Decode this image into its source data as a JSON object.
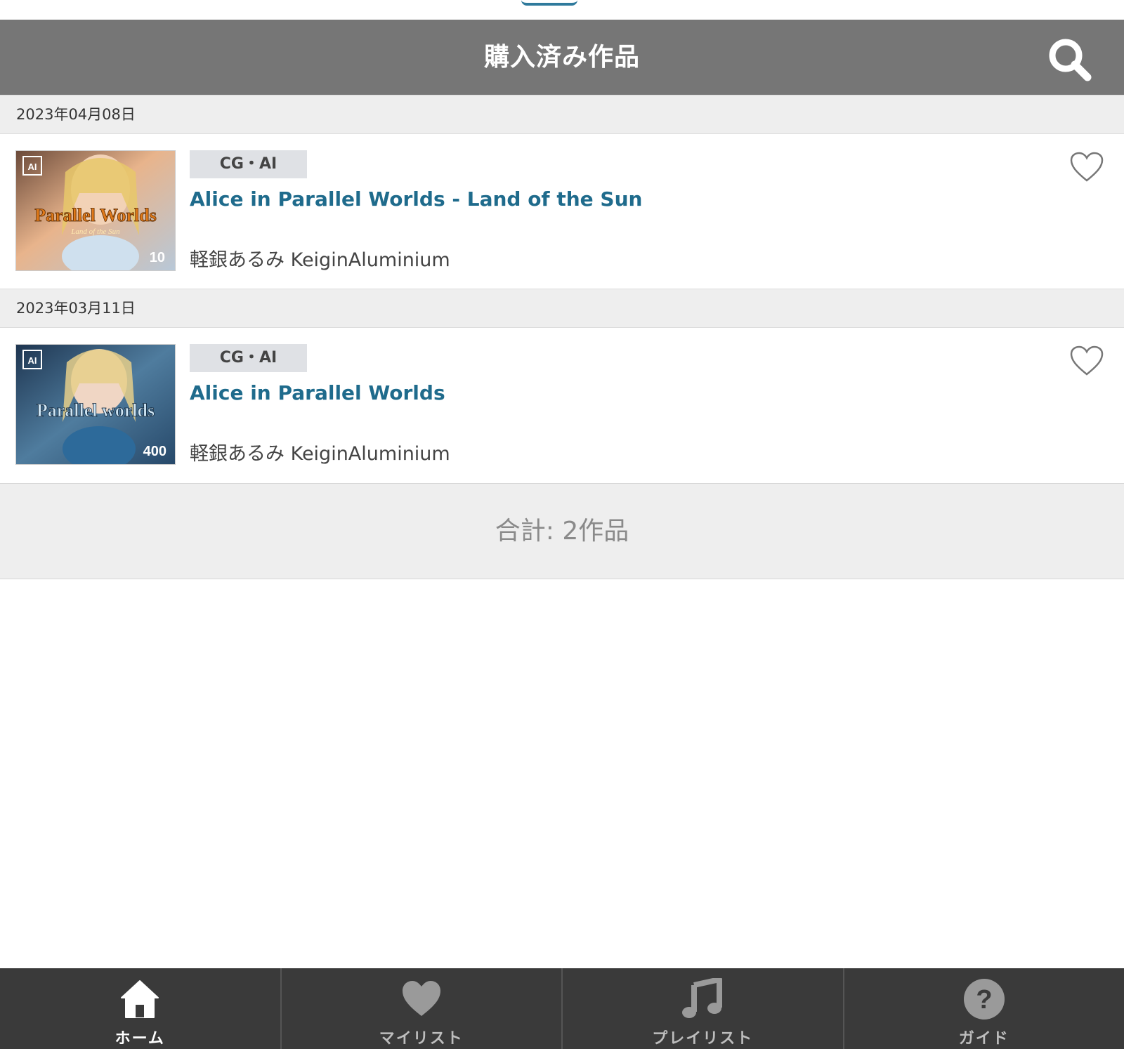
{
  "header": {
    "title": "購入済み作品"
  },
  "groups": [
    {
      "date": "2023年04月08日",
      "item": {
        "category": "CG・AI",
        "title": "Alice in Parallel Worlds - Land of the Sun",
        "author": "軽銀あるみ KeiginAluminium",
        "cover_title": "Parallel Worlds",
        "cover_subtitle": "Land of the Sun",
        "cover_number": "10",
        "cover_logo": "AI"
      }
    },
    {
      "date": "2023年03月11日",
      "item": {
        "category": "CG・AI",
        "title": "Alice in Parallel Worlds",
        "author": "軽銀あるみ KeiginAluminium",
        "cover_title": "Parallel worlds",
        "cover_number": "400",
        "cover_logo": "AI"
      }
    }
  ],
  "summary": {
    "total": "合計: 2作品"
  },
  "tabbar": {
    "tabs": [
      {
        "label": "ホーム",
        "icon": "home-icon",
        "active": true
      },
      {
        "label": "マイリスト",
        "icon": "heart-icon",
        "active": false
      },
      {
        "label": "プレイリスト",
        "icon": "music-note-icon",
        "active": false
      },
      {
        "label": "ガイド",
        "icon": "help-icon",
        "active": false
      }
    ]
  },
  "colors": {
    "header": "#767676",
    "link": "#1f6b8c",
    "tabbar": "#3a3a3a"
  }
}
